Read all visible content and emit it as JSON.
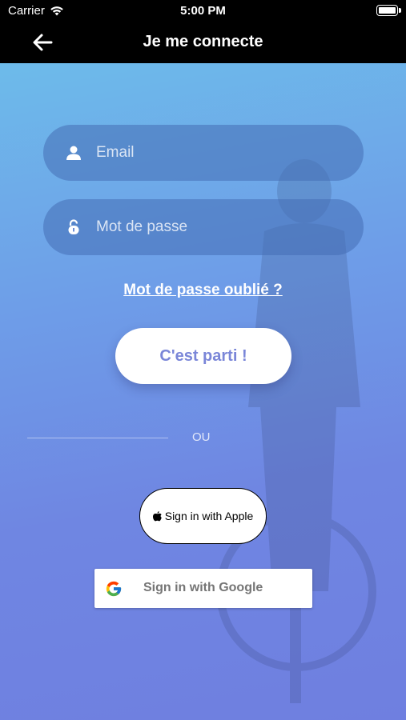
{
  "status_bar": {
    "carrier": "Carrier",
    "time": "5:00 PM"
  },
  "nav": {
    "title": "Je me connecte"
  },
  "form": {
    "email_placeholder": "Email",
    "password_placeholder": "Mot de passe",
    "forgot_label": "Mot de passe oublié ?",
    "submit_label": "C'est parti !"
  },
  "divider": {
    "label": "OU"
  },
  "social": {
    "apple_label": "Sign in with Apple",
    "google_label": "Sign in with Google"
  },
  "colors": {
    "button_text": "#7a86d8",
    "background_top": "#6dbbea",
    "background_bottom": "#6f7fe0"
  }
}
